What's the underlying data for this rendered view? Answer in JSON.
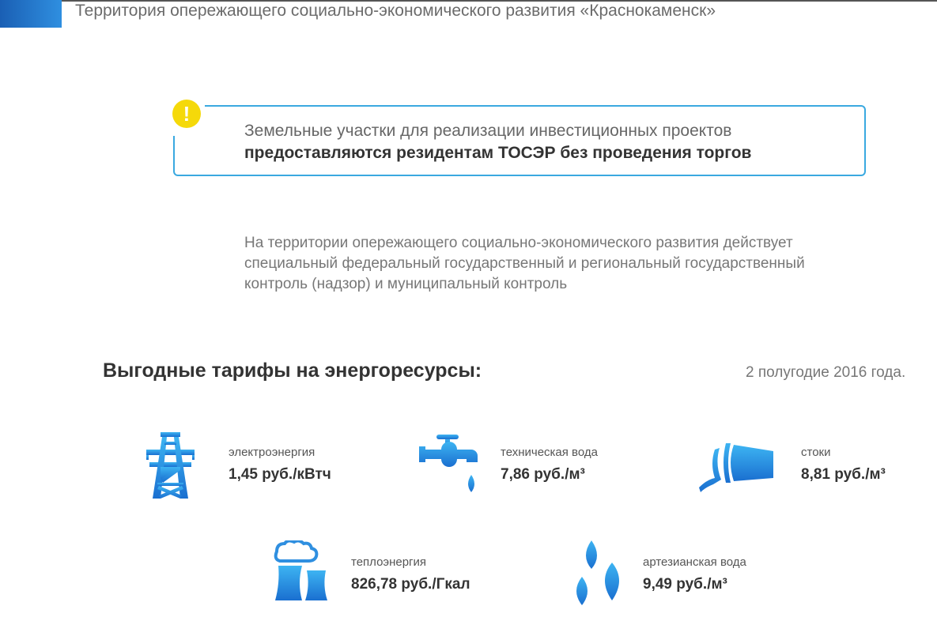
{
  "header": {
    "title": "Территория опережающего социально-экономического развития «Краснокаменск»"
  },
  "notice": {
    "icon": "exclamation-icon",
    "line1": "Земельные участки для реализации инвестиционных проектов",
    "line2": "предоставляются резидентам ТОСЭР без проведения торгов",
    "alert_symbol": "!"
  },
  "paragraph": "На территории опережающего социально-экономического развития действует специальный федеральный государственный и региональный государственный контроль (надзор) и муниципальный контроль",
  "tariffs_section": {
    "title": "Выгодные тарифы на энергоресурсы:",
    "period": "2 полугодие 2016 года.",
    "items": [
      {
        "icon": "power-tower-icon",
        "label": "электроэнергия",
        "value": "1,45 руб./кВтч"
      },
      {
        "icon": "water-tap-icon",
        "label": "техническая вода",
        "value": "7,86 руб./м³"
      },
      {
        "icon": "drain-pipe-icon",
        "label": "стоки",
        "value": "8,81 руб./м³"
      },
      {
        "icon": "cooling-tower-icon",
        "label": "теплоэнергия",
        "value": "826,78 руб./Гкал"
      },
      {
        "icon": "water-drops-icon",
        "label": "артезианская вода",
        "value": "9,49 руб./м³"
      }
    ]
  },
  "colors": {
    "accent": "#2f8fe0",
    "border": "#3aa9e0",
    "alert": "#f5d90a"
  }
}
